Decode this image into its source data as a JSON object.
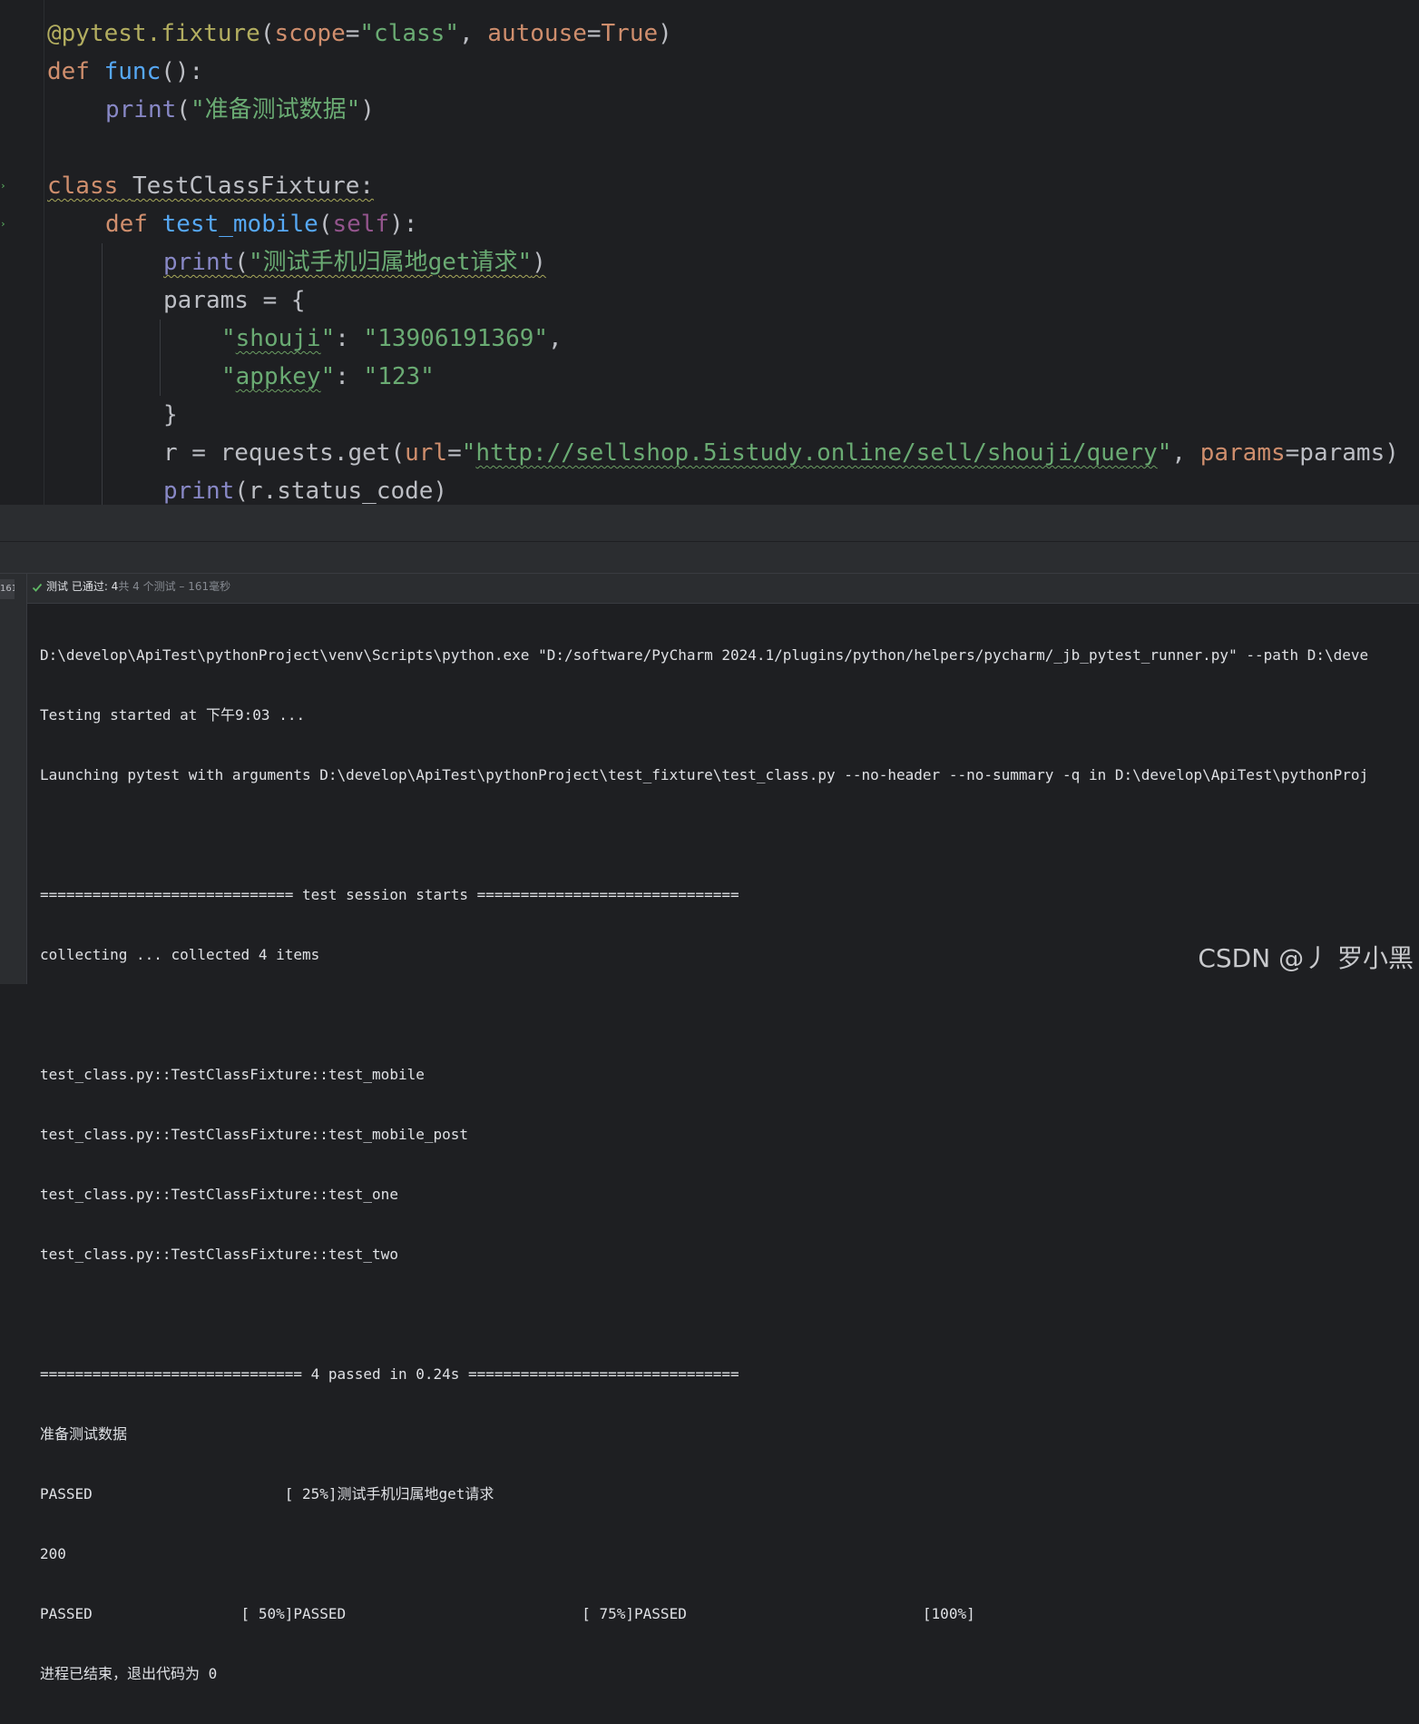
{
  "editor": {
    "line1": {
      "decorator": "@pytest.fixture",
      "open": "(",
      "p1": "scope",
      "eq1": "=",
      "v1": "\"class\"",
      "comma": ", ",
      "p2": "autouse",
      "eq2": "=",
      "v2": "True",
      "close": ")"
    },
    "line2": {
      "kw": "def",
      "name": "func",
      "rest": "():"
    },
    "line3": {
      "fn": "print",
      "open": "(",
      "str": "\"准备测试数据\"",
      "close": ")"
    },
    "line5": {
      "kw": "class",
      "name": "TestClassFixture:"
    },
    "line6": {
      "kw": "def",
      "name": "test_mobile",
      "open": "(",
      "self": "self",
      "close": "):"
    },
    "line7": {
      "fn": "print",
      "open": "(",
      "str": "\"测试手机归属地get请求\"",
      "close": ")"
    },
    "line8": {
      "text": "params = {"
    },
    "line9": {
      "q1": "\"",
      "key": "shouji",
      "q2": "\"",
      "colon": ": ",
      "val": "\"13906191369\"",
      "comma": ","
    },
    "line10": {
      "q1": "\"",
      "key": "appkey",
      "q2": "\"",
      "colon": ": ",
      "val": "\"123\""
    },
    "line11": {
      "text": "}"
    },
    "line12": {
      "pre": "r = requests.get(",
      "p1": "url",
      "eq1": "=",
      "q1": "\"",
      "url": "http://sellshop.5istudy.online/sell/shouji/query",
      "q2": "\"",
      "comma": ", ",
      "p2": "params",
      "eq2": "=",
      "v2": "params)"
    },
    "line13": {
      "fn": "print",
      "rest": "(r.status_code)"
    }
  },
  "run_panel": {
    "time_tab": "161毫秒",
    "status_prefix": "测试 已通过: 4",
    "status_detail": "共 4 个测试 – 161毫秒",
    "console_lines": [
      "D:\\develop\\ApiTest\\pythonProject\\venv\\Scripts\\python.exe \"D:/software/PyCharm 2024.1/plugins/python/helpers/pycharm/_jb_pytest_runner.py\" --path D:\\deve",
      "Testing started at 下午9:03 ...",
      "Launching pytest with arguments D:\\develop\\ApiTest\\pythonProject\\test_fixture\\test_class.py --no-header --no-summary -q in D:\\develop\\ApiTest\\pythonProj",
      "",
      "============================= test session starts ==============================",
      "collecting ... collected 4 items",
      "",
      "test_class.py::TestClassFixture::test_mobile",
      "test_class.py::TestClassFixture::test_mobile_post",
      "test_class.py::TestClassFixture::test_one",
      "test_class.py::TestClassFixture::test_two",
      "",
      "============================== 4 passed in 0.24s ===============================",
      "准备测试数据",
      "PASSED                      [ 25%]测试手机归属地get请求",
      "200",
      "PASSED                 [ 50%]PASSED                           [ 75%]PASSED                           [100%]",
      "进程已结束，退出代码为 0"
    ]
  },
  "watermark": "CSDN @丿 罗小黑",
  "colors": {
    "background": "#1e1f22",
    "keyword": "#cf8e6d",
    "string": "#6aab73",
    "function": "#56a8f5",
    "builtin": "#8888c6",
    "pass": "#5fb865"
  }
}
